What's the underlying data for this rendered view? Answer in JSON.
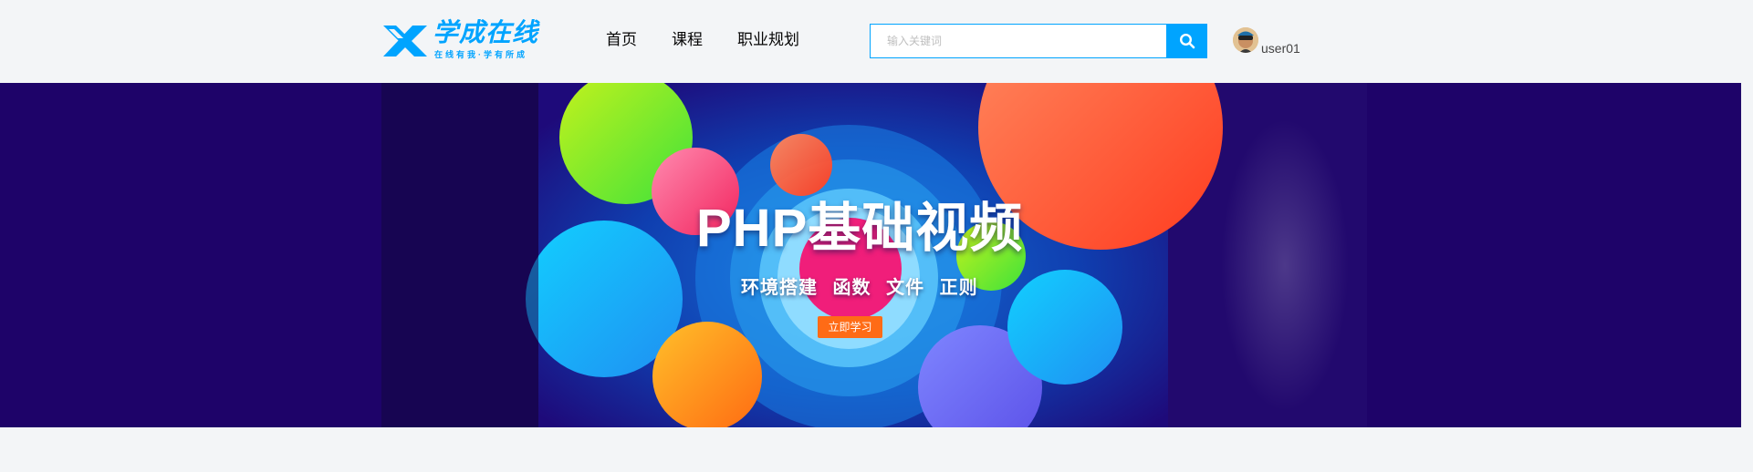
{
  "header": {
    "logo": {
      "brand": "学成在线",
      "slogan": "在线有我·学有所成"
    },
    "nav": [
      {
        "label": "首页"
      },
      {
        "label": "课程"
      },
      {
        "label": "职业规划"
      }
    ],
    "search": {
      "placeholder": "输入关键词",
      "value": ""
    },
    "user": {
      "name": "user01"
    }
  },
  "banner": {
    "title": "PHP基础视频",
    "subtitle": "环境搭建  函数 文件  正则",
    "cta": "立即学习"
  },
  "colors": {
    "accent": "#00a4ff",
    "banner_bg": "#1e0369",
    "cta": "#ff6b16",
    "page_bg": "#f3f5f7"
  },
  "icons": [
    "logo-x-mark",
    "search-icon",
    "user-avatar"
  ]
}
